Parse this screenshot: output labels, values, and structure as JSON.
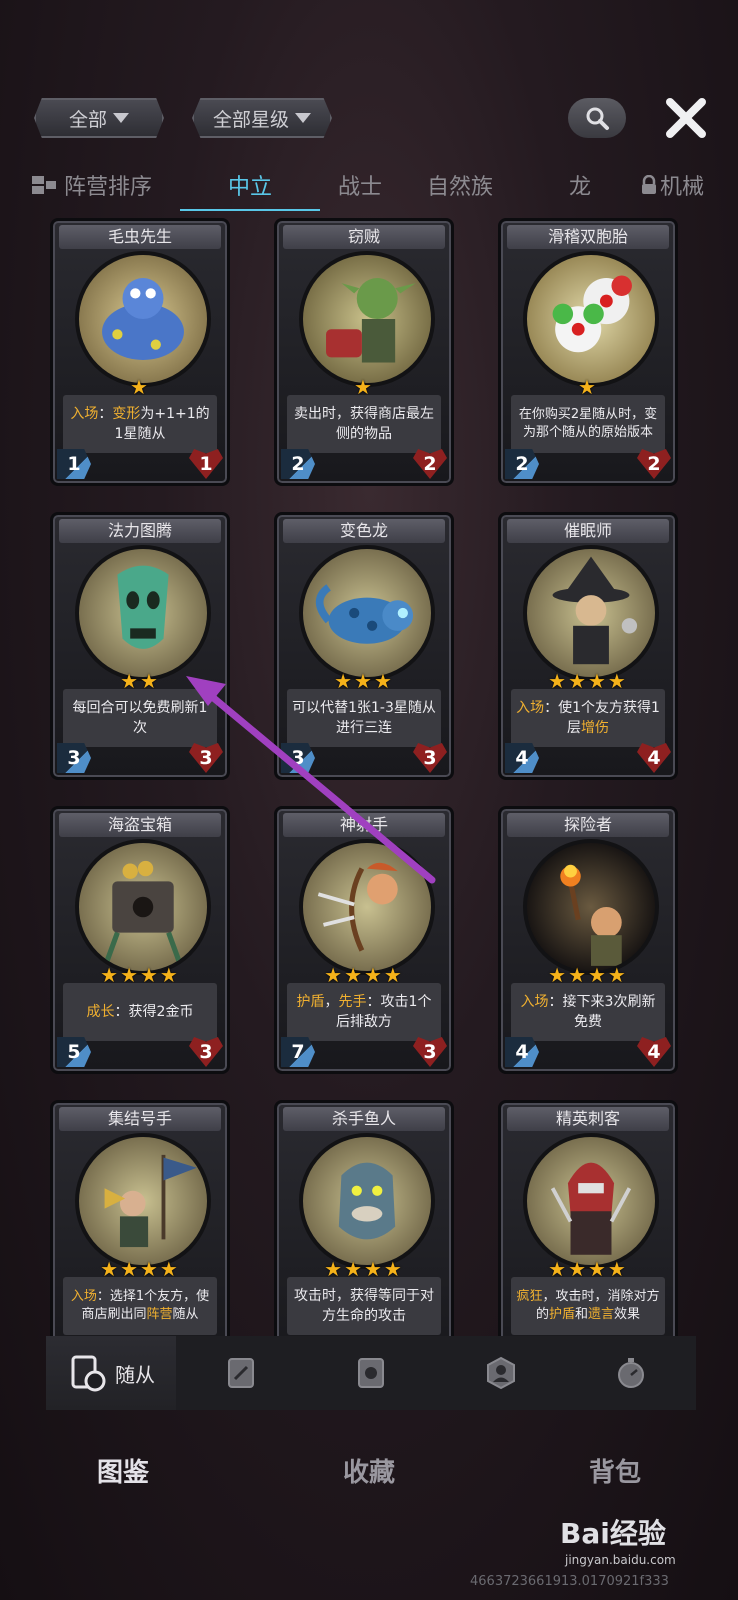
{
  "filters": {
    "faction": "全部",
    "stars": "全部星级"
  },
  "tabs": [
    {
      "label": "阵营排序"
    },
    {
      "label": "中立"
    },
    {
      "label": "战士"
    },
    {
      "label": "自然族"
    },
    {
      "label": "龙"
    },
    {
      "label": "机械"
    }
  ],
  "cards": [
    {
      "name": "毛虫先生",
      "stars": "★",
      "atk": "1",
      "hp": "1",
      "desc_a": "入场",
      "desc_b": "：",
      "desc_c": "变形",
      "desc_d": "为+1+1的1星随从",
      "art": "#4a76c8"
    },
    {
      "name": "窃贼",
      "stars": "★",
      "atk": "2",
      "hp": "2",
      "desc": "卖出时，获得商店最左侧的物品",
      "art": "#5a8a4a"
    },
    {
      "name": "滑稽双胞胎",
      "stars": "★",
      "atk": "2",
      "hp": "2",
      "desc": "在你购买2星随从时，变为那个随从的原始版本",
      "art": "#d84040"
    },
    {
      "name": "法力图腾",
      "stars": "★★",
      "atk": "3",
      "hp": "3",
      "desc": "每回合可以免费刷新1次",
      "art": "#4aa88a"
    },
    {
      "name": "变色龙",
      "stars": "★★★",
      "atk": "3",
      "hp": "3",
      "desc": "可以代替1张1-3星随从进行三连",
      "art": "#3a7ab8"
    },
    {
      "name": "催眠师",
      "stars": "★★★★",
      "atk": "4",
      "hp": "4",
      "desc_a": "入场",
      "desc_b": "：使1个友方获得1层",
      "desc_c": "增伤",
      "art": "#6a6a6a"
    },
    {
      "name": "海盗宝箱",
      "stars": "★★★★",
      "atk": "5",
      "hp": "3",
      "desc_a": "成长",
      "desc_b": "：获得2金币",
      "art": "#5a5048"
    },
    {
      "name": "神射手",
      "stars": "★★★★",
      "atk": "7",
      "hp": "3",
      "desc_a": "护盾",
      "desc_b": "，",
      "desc_c": "先手",
      "desc_d": "：攻击1个后排敌方",
      "art": "#b86a3a"
    },
    {
      "name": "探险者",
      "stars": "★★★★",
      "atk": "4",
      "hp": "4",
      "desc_a": "入场",
      "desc_b": "：接下来3次刷新免费",
      "art": "#c87a2a"
    },
    {
      "name": "集结号手",
      "stars": "★★★★",
      "desc_a": "入场",
      "desc_b": "：选择1个友方，使商店刷出同",
      "desc_c": "阵营",
      "desc_d": "随从",
      "art": "#7a8a5a"
    },
    {
      "name": "杀手鱼人",
      "stars": "★★★★",
      "desc": "攻击时，获得等同于对方生命的攻击",
      "art": "#5a7a8a"
    },
    {
      "name": "精英刺客",
      "stars": "★★★★",
      "desc_a": "疯狂",
      "desc_b": "，攻击时，消除对方的",
      "desc_c": "护盾",
      "desc_d": "和",
      "desc_e": "遗言",
      "desc_f": "效果",
      "art": "#a83030"
    }
  ],
  "category_bar": {
    "minion_label": "随从"
  },
  "bottom_nav": [
    {
      "label": "图鉴"
    },
    {
      "label": "收藏"
    },
    {
      "label": "背包"
    }
  ],
  "watermark": {
    "logo": "Bai经验",
    "site": "jingyan.baidu.com",
    "id": "4663723661913.0170921f333"
  },
  "colors": {
    "active_tab": "#59c7e8",
    "star": "#f5b21a",
    "keyword": "#f0b030",
    "arrow": "#a040c0"
  }
}
